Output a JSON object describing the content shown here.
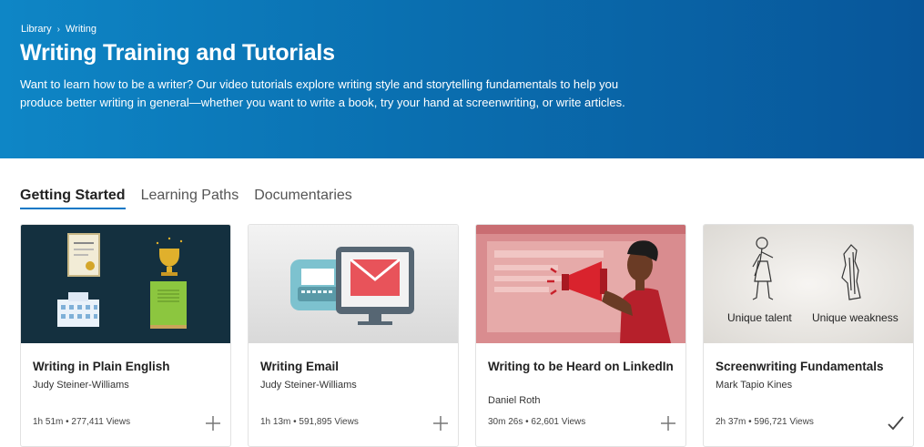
{
  "header": {
    "breadcrumb": [
      "Library",
      "Writing"
    ],
    "breadcrumb_sep": "›",
    "title": "Writing Training and Tutorials",
    "description": "Want to learn how to be a writer? Our video tutorials explore writing style and storytelling fundamentals to help you produce better writing in general—whether you want to write a book, try your hand at screenwriting, or write articles."
  },
  "tabs": [
    {
      "label": "Getting Started",
      "active": true
    },
    {
      "label": "Learning Paths",
      "active": false
    },
    {
      "label": "Documentaries",
      "active": false
    }
  ],
  "courses": [
    {
      "title": "Writing in Plain English",
      "author": "Judy Steiner-Williams",
      "meta": "1h 51m • 277,411 Views",
      "action": "plus-icon"
    },
    {
      "title": "Writing Email",
      "author": "Judy Steiner-Williams",
      "meta": "1h 13m • 591,895 Views",
      "action": "plus-icon"
    },
    {
      "title": "Writing to be Heard on LinkedIn",
      "author": "Daniel Roth",
      "meta": "30m 26s • 62,601 Views",
      "action": "plus-icon"
    },
    {
      "title": "Screenwriting Fundamentals",
      "author": "Mark Tapio Kines",
      "meta": "2h 37m • 596,721 Views",
      "action": "check-icon",
      "thumb_labels": [
        "Unique talent",
        "Unique weakness"
      ]
    }
  ],
  "colors": {
    "hero_start": "#0e86c6",
    "hero_end": "#08569a",
    "tab_underline": "#0a78c6"
  }
}
